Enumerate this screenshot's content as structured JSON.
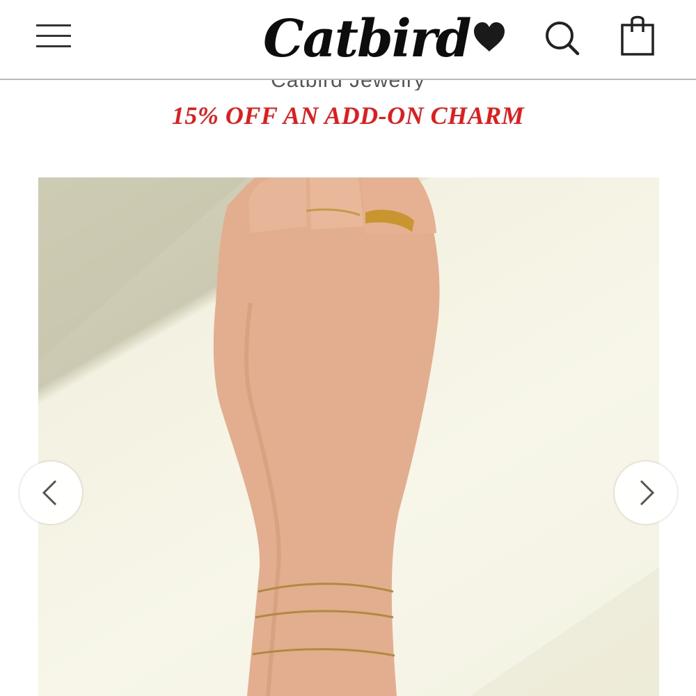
{
  "header": {
    "logo_text": "Catbird",
    "icons": {
      "menu": "hamburger-menu-icon",
      "wishlist": "heart-icon",
      "search": "search-icon",
      "cart": "shopping-bag-icon"
    }
  },
  "subtitle": "Catbird Jewelry",
  "promo": {
    "text": "15% OFF AN ADD-ON CHARM",
    "color": "#e41b1b"
  },
  "product": {
    "image_description": "hand-with-rings-and-chain-bracelets"
  },
  "carousel": {
    "prev_icon": "chevron-left-icon",
    "next_icon": "chevron-right-icon"
  }
}
